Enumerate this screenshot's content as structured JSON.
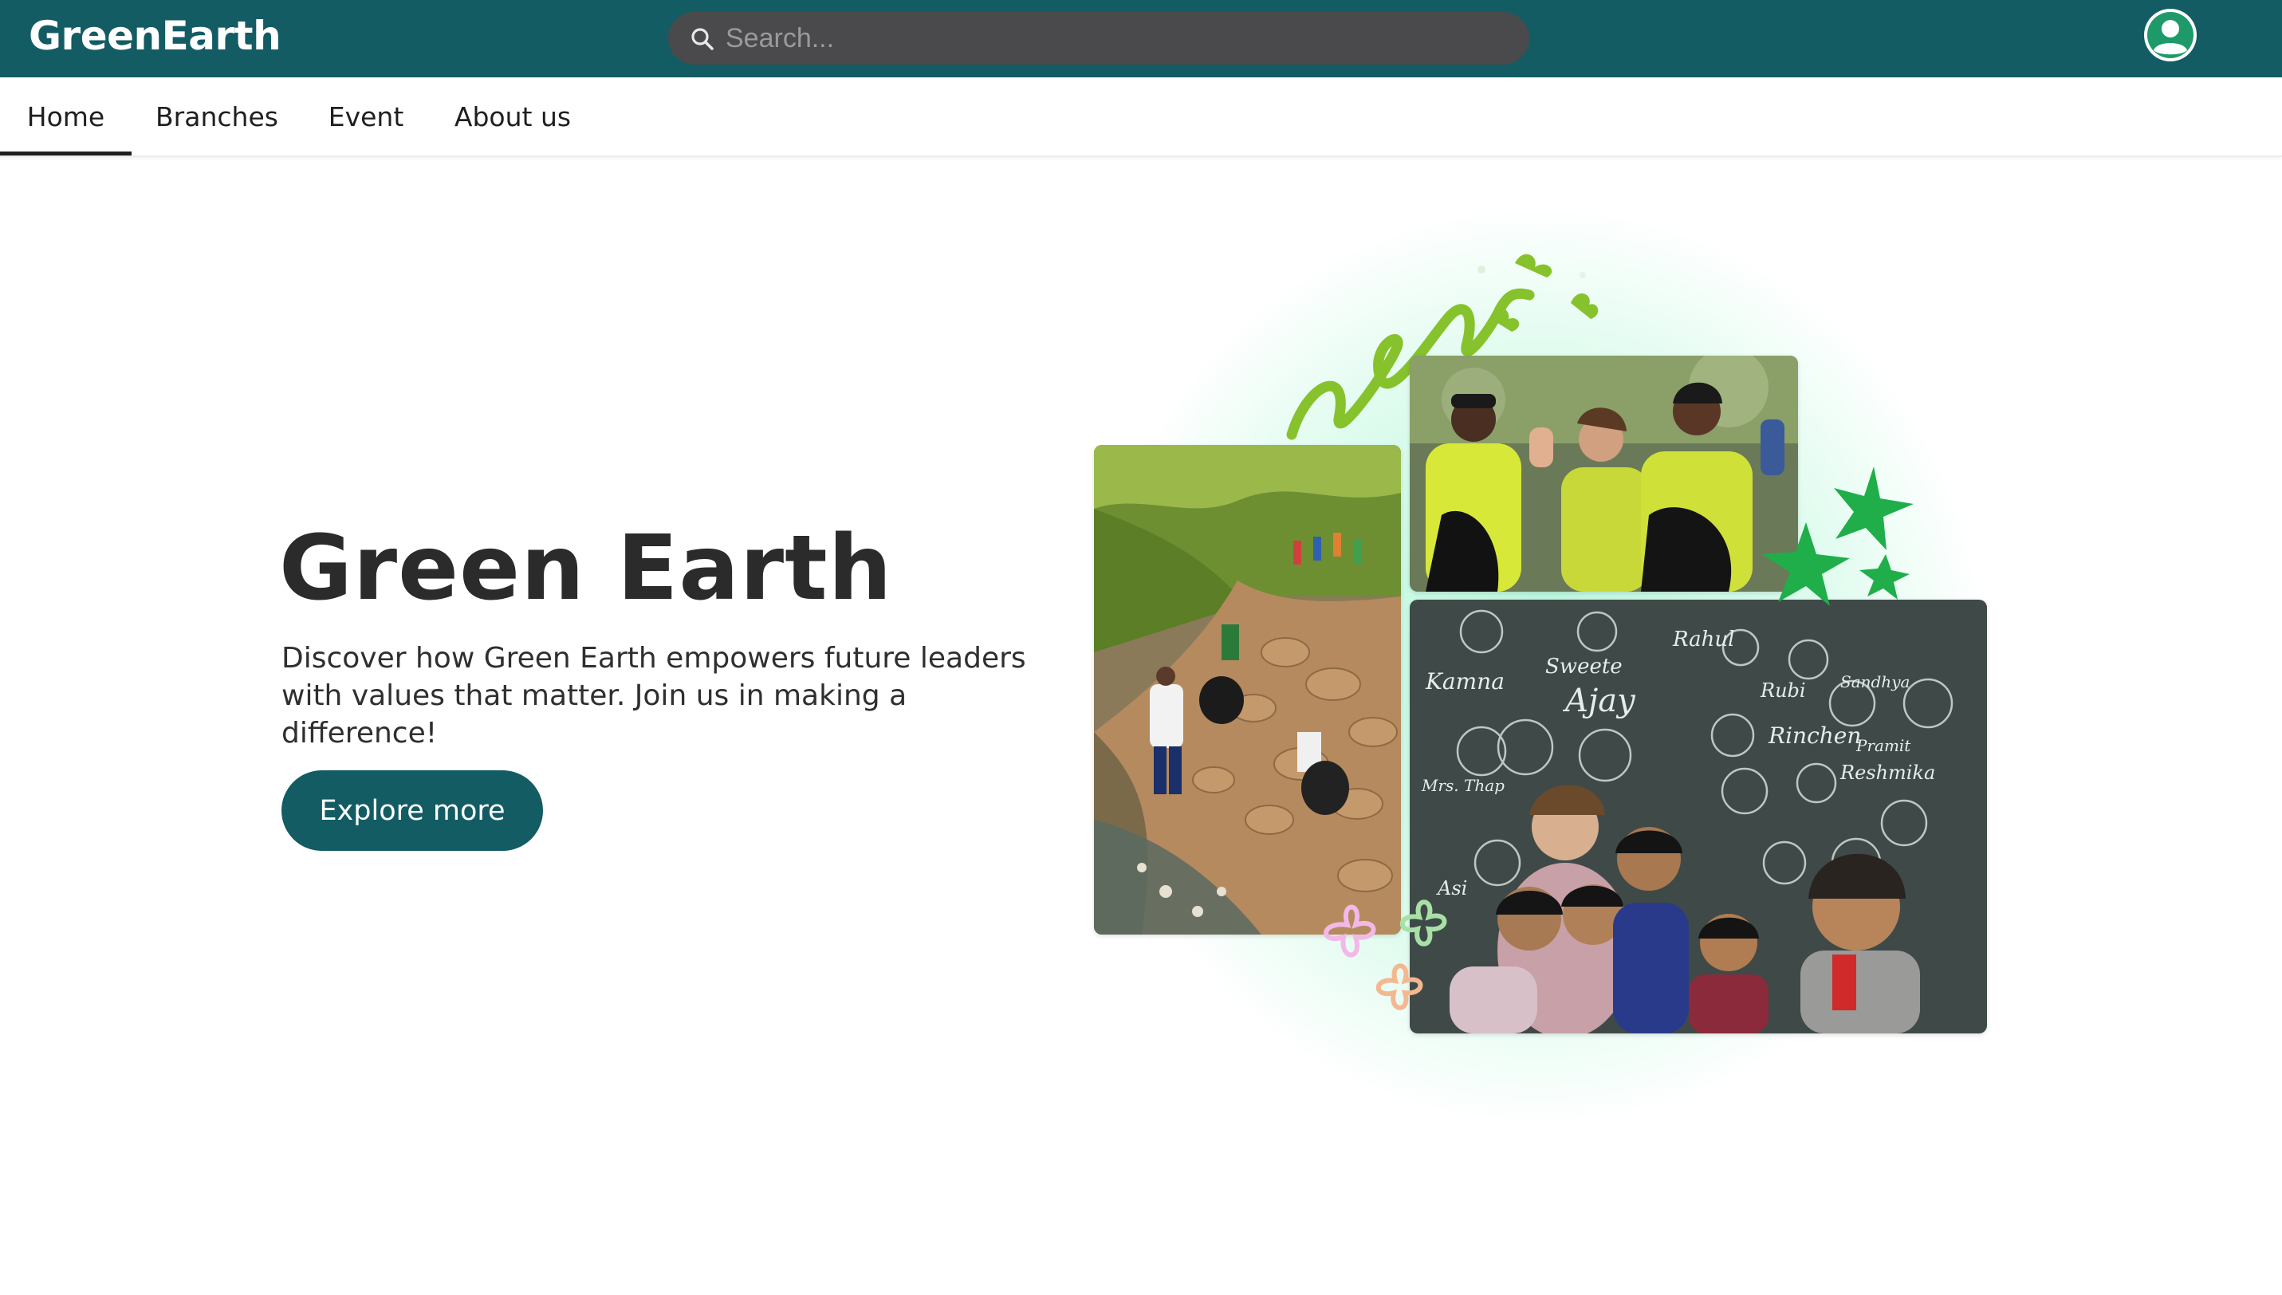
{
  "header": {
    "brand": "GreenEarth",
    "search_placeholder": "Search...",
    "avatar_icon": "user-account-icon",
    "search_icon": "search-icon"
  },
  "nav": {
    "tabs": [
      {
        "label": "Home",
        "active": true
      },
      {
        "label": "Branches",
        "active": false
      },
      {
        "label": "Event",
        "active": false
      },
      {
        "label": "About us",
        "active": false
      }
    ]
  },
  "hero": {
    "title": "Green Earth",
    "description": "Discover how Green Earth empowers future leaders with values that matter. Join us in making a difference!",
    "cta_label": "Explore more"
  },
  "collage": {
    "blackboard_names": [
      "Kamna",
      "Sweete",
      "Ajay",
      "Rahul",
      "Rubi",
      "Sandhya",
      "Rinchen",
      "Pramit",
      "Reshmika",
      "Mrs. Thap",
      "Asi"
    ]
  },
  "colors": {
    "header_bg": "#135c64",
    "accent": "#135c64",
    "search_bg": "#4a4a4c",
    "star_green": "#1fae4a",
    "vine_green": "#7cc02a"
  }
}
